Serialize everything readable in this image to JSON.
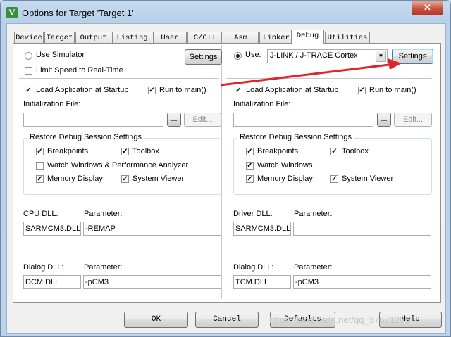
{
  "window": {
    "title": "Options for Target 'Target 1'",
    "close_glyph": "✕"
  },
  "tabs": [
    "Device",
    "Target",
    "Output",
    "Listing",
    "User",
    "C/C++",
    "Asm",
    "Linker",
    "Debug",
    "Utilities"
  ],
  "active_tab": "Debug",
  "left": {
    "use_simulator": "Use Simulator",
    "limit_speed": "Limit Speed to Real-Time",
    "settings": "Settings",
    "load_app": "Load Application at Startup",
    "run_main": "Run to main()",
    "init_file_label": "Initialization File:",
    "init_file_value": "",
    "browse": "...",
    "edit": "Edit...",
    "restore_group": "Restore Debug Session Settings",
    "breakpoints": "Breakpoints",
    "toolbox": "Toolbox",
    "watch_windows": "Watch Windows & Performance Analyzer",
    "memory_display": "Memory Display",
    "system_viewer": "System Viewer",
    "cpu_dll_label": "CPU DLL:",
    "cpu_dll_value": "SARMCM3.DLL",
    "cpu_param_label": "Parameter:",
    "cpu_param_value": "-REMAP",
    "dialog_dll_label": "Dialog DLL:",
    "dialog_dll_value": "DCM.DLL",
    "dialog_param_label": "Parameter:",
    "dialog_param_value": "-pCM3"
  },
  "right": {
    "use": "Use:",
    "debugger": "J-LINK / J-TRACE Cortex",
    "settings": "Settings",
    "load_app": "Load Application at Startup",
    "run_main": "Run to main()",
    "init_file_label": "Initialization File:",
    "init_file_value": "",
    "browse": "...",
    "edit": "Edit...",
    "restore_group": "Restore Debug Session Settings",
    "breakpoints": "Breakpoints",
    "toolbox": "Toolbox",
    "watch_windows": "Watch Windows",
    "memory_display": "Memory Display",
    "system_viewer": "System Viewer",
    "driver_dll_label": "Driver DLL:",
    "driver_dll_value": "SARMCM3.DLL",
    "driver_param_label": "Parameter:",
    "driver_param_value": "",
    "dialog_dll_label": "Dialog DLL:",
    "dialog_dll_value": "TCM.DLL",
    "dialog_param_label": "Parameter:",
    "dialog_param_value": "-pCM3"
  },
  "check_glyph": "✓",
  "footer": {
    "ok": "OK",
    "cancel": "Cancel",
    "defaults": "Defaults",
    "help": "Help"
  },
  "watermark": "https://blog.csdn.net/qq_37671205",
  "colors": {
    "annotation_arrow": "#e0232d",
    "title_bar": "#c6dbef",
    "close_button": "#c9513d"
  }
}
